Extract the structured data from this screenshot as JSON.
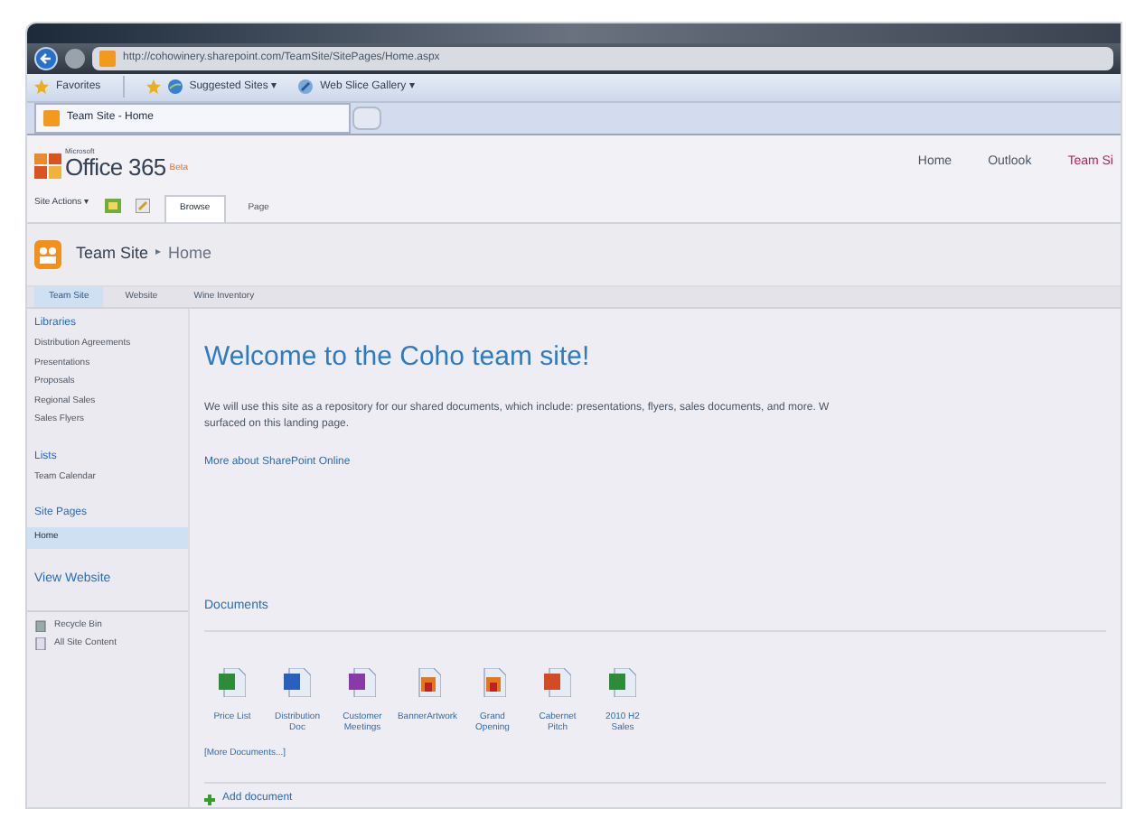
{
  "browser": {
    "address": "http://cohowinery.sharepoint.com/TeamSite/SitePages/Home.aspx",
    "favorites": [
      {
        "kind": "favorites",
        "label": "Favorites"
      },
      {
        "kind": "suggested",
        "label": "Suggested Sites ▾"
      },
      {
        "kind": "webslice",
        "label": "Web Slice Gallery ▾"
      }
    ],
    "tab": "Team Site - Home"
  },
  "suite": {
    "logo_small": "Microsoft",
    "logo": "Office 365",
    "logo_badge": "Beta",
    "nav": [
      {
        "label": "Home",
        "selected": false
      },
      {
        "label": "Outlook",
        "selected": false
      },
      {
        "label": "Team Si",
        "selected": true
      }
    ]
  },
  "ribbon": {
    "site_actions": "Site Actions ▾",
    "tabs": [
      {
        "label": "Browse",
        "selected": true
      },
      {
        "label": "Page",
        "selected": false
      }
    ]
  },
  "breadcrumb": {
    "site": "Team Site",
    "separator": "▸",
    "page": "Home"
  },
  "top_nav": [
    {
      "label": "Team Site",
      "selected": true
    },
    {
      "label": "Website",
      "selected": false
    },
    {
      "label": "Wine Inventory",
      "selected": false
    }
  ],
  "quick_launch": {
    "sections": [
      {
        "heading": "Libraries",
        "items": [
          {
            "label": "Distribution Agreements",
            "selected": false
          },
          {
            "label": "Presentations",
            "selected": false
          },
          {
            "label": "Proposals",
            "selected": false
          },
          {
            "label": "Regional Sales",
            "selected": false
          },
          {
            "label": "Sales Flyers",
            "selected": false
          }
        ]
      },
      {
        "heading": "Lists",
        "items": [
          {
            "label": "Team Calendar",
            "selected": false
          }
        ]
      },
      {
        "heading": "Site Pages",
        "items": [
          {
            "label": "Home",
            "selected": true
          }
        ]
      },
      {
        "heading": "View Website"
      }
    ],
    "footer": [
      {
        "kind": "recycle",
        "label": "Recycle Bin"
      },
      {
        "kind": "content",
        "label": "All Site Content"
      }
    ]
  },
  "content": {
    "title": "Welcome to the Coho team site!",
    "intro_line_1": "We will use this site as a repository for our shared documents, which include: presentations, flyers, sales documents, and more. W",
    "intro_line_2": "surfaced on this landing page.",
    "link": "More about SharePoint Online",
    "documents": {
      "heading": "Documents",
      "items": [
        {
          "kind": "excel",
          "label": "Price List"
        },
        {
          "kind": "word",
          "label": "Distribution Doc"
        },
        {
          "kind": "onenote",
          "label": "Customer Meetings"
        },
        {
          "kind": "image",
          "label": "BannerArtwork"
        },
        {
          "kind": "image",
          "label": "Grand Opening"
        },
        {
          "kind": "powerpoint",
          "label": "Cabernet Pitch"
        },
        {
          "kind": "excel",
          "label": "2010 H2 Sales"
        }
      ],
      "more": "[More Documents...]",
      "add": "Add document"
    }
  }
}
